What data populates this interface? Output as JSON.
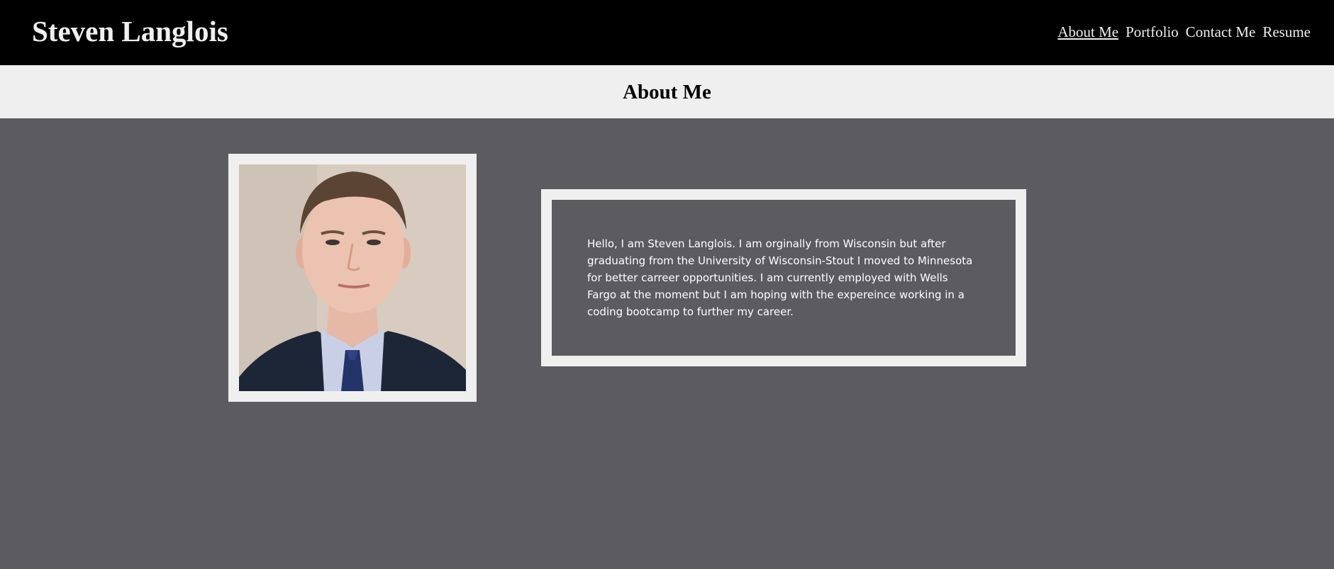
{
  "header": {
    "site_title": "Steven Langlois",
    "nav": [
      {
        "label": "About Me",
        "active": true
      },
      {
        "label": "Portfolio",
        "active": false
      },
      {
        "label": "Contact Me",
        "active": false
      },
      {
        "label": "Resume",
        "active": false
      }
    ]
  },
  "section": {
    "title": "About Me"
  },
  "about": {
    "bio": "Hello, I am Steven Langlois. I am orginally from Wisconsin but after graduating from the University of Wisconsin-Stout I moved to Minnesota for better carreer opportunities. I am currently employed with Wells Fargo at the moment but I am hoping with the expereince working in a coding bootcamp to further my career."
  },
  "colors": {
    "header_bg": "#000000",
    "section_header_bg": "#f0eff0",
    "page_bg": "#5c5b60",
    "frame": "#f0eff0",
    "text_light": "#f0eff0"
  }
}
